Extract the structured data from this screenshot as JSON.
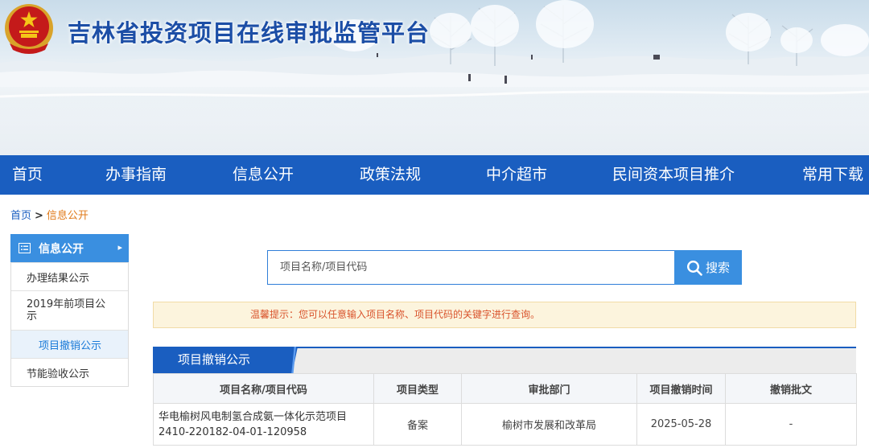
{
  "header": {
    "site_title": "吉林省投资项目在线审批监管平台",
    "emblem": "national-emblem"
  },
  "nav": {
    "items": [
      {
        "label": "首页"
      },
      {
        "label": "办事指南"
      },
      {
        "label": "信息公开"
      },
      {
        "label": "政策法规"
      },
      {
        "label": "中介超市"
      },
      {
        "label": "民间资本项目推介"
      },
      {
        "label": "常用下载"
      }
    ]
  },
  "breadcrumb": {
    "home": "首页",
    "separator": ">",
    "current": "信息公开"
  },
  "sidebar": {
    "title": "信息公开",
    "title_icon": "list-icon",
    "arrow": "▸",
    "items": [
      {
        "label": "办理结果公示",
        "active": false
      },
      {
        "label": "2019年前项目公示",
        "active": false
      },
      {
        "label": "项目撤销公示",
        "active": true
      },
      {
        "label": "节能验收公示",
        "active": false
      }
    ]
  },
  "search": {
    "placeholder": "项目名称/项目代码",
    "value": "",
    "button_label": "搜索",
    "button_icon": "search-icon"
  },
  "tip": {
    "text": "温馨提示：您可以任意输入项目名称、项目代码的关键字进行查询。"
  },
  "section": {
    "title": "项目撤销公示"
  },
  "table": {
    "columns": [
      "项目名称/项目代码",
      "项目类型",
      "审批部门",
      "项目撤销时间",
      "撤销批文"
    ],
    "rows": [
      {
        "name": "华电榆树风电制氢合成氨一体化示范项目",
        "code": "2410-220182-04-01-120958",
        "type": "备案",
        "dept": "榆树市发展和改革局",
        "date": "2025-05-28",
        "doc": "-"
      }
    ]
  },
  "colors": {
    "nav_blue": "#1a5ec0",
    "accent_blue": "#3a8fe0",
    "breadcrumb_current": "#e07a1a",
    "tip_text": "#d9532c",
    "tip_bg": "#fcf4dd"
  }
}
